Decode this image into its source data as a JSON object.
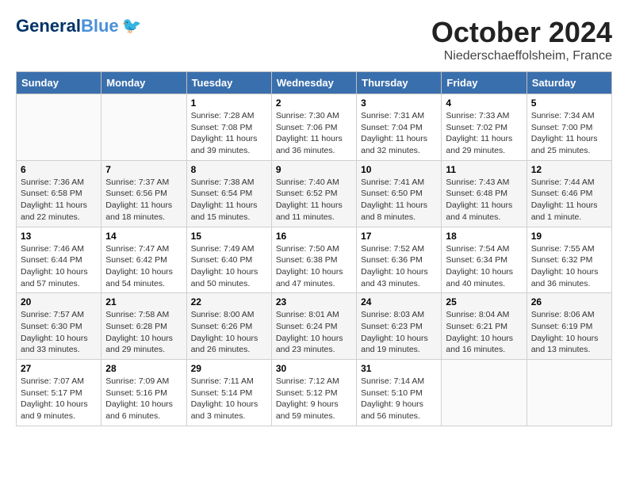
{
  "header": {
    "logo_line1": "General",
    "logo_line2": "Blue",
    "month": "October 2024",
    "location": "Niederschaeffolsheim, France"
  },
  "weekdays": [
    "Sunday",
    "Monday",
    "Tuesday",
    "Wednesday",
    "Thursday",
    "Friday",
    "Saturday"
  ],
  "weeks": [
    [
      {
        "day": "",
        "sunrise": "",
        "sunset": "",
        "daylight": ""
      },
      {
        "day": "",
        "sunrise": "",
        "sunset": "",
        "daylight": ""
      },
      {
        "day": "1",
        "sunrise": "Sunrise: 7:28 AM",
        "sunset": "Sunset: 7:08 PM",
        "daylight": "Daylight: 11 hours and 39 minutes."
      },
      {
        "day": "2",
        "sunrise": "Sunrise: 7:30 AM",
        "sunset": "Sunset: 7:06 PM",
        "daylight": "Daylight: 11 hours and 36 minutes."
      },
      {
        "day": "3",
        "sunrise": "Sunrise: 7:31 AM",
        "sunset": "Sunset: 7:04 PM",
        "daylight": "Daylight: 11 hours and 32 minutes."
      },
      {
        "day": "4",
        "sunrise": "Sunrise: 7:33 AM",
        "sunset": "Sunset: 7:02 PM",
        "daylight": "Daylight: 11 hours and 29 minutes."
      },
      {
        "day": "5",
        "sunrise": "Sunrise: 7:34 AM",
        "sunset": "Sunset: 7:00 PM",
        "daylight": "Daylight: 11 hours and 25 minutes."
      }
    ],
    [
      {
        "day": "6",
        "sunrise": "Sunrise: 7:36 AM",
        "sunset": "Sunset: 6:58 PM",
        "daylight": "Daylight: 11 hours and 22 minutes."
      },
      {
        "day": "7",
        "sunrise": "Sunrise: 7:37 AM",
        "sunset": "Sunset: 6:56 PM",
        "daylight": "Daylight: 11 hours and 18 minutes."
      },
      {
        "day": "8",
        "sunrise": "Sunrise: 7:38 AM",
        "sunset": "Sunset: 6:54 PM",
        "daylight": "Daylight: 11 hours and 15 minutes."
      },
      {
        "day": "9",
        "sunrise": "Sunrise: 7:40 AM",
        "sunset": "Sunset: 6:52 PM",
        "daylight": "Daylight: 11 hours and 11 minutes."
      },
      {
        "day": "10",
        "sunrise": "Sunrise: 7:41 AM",
        "sunset": "Sunset: 6:50 PM",
        "daylight": "Daylight: 11 hours and 8 minutes."
      },
      {
        "day": "11",
        "sunrise": "Sunrise: 7:43 AM",
        "sunset": "Sunset: 6:48 PM",
        "daylight": "Daylight: 11 hours and 4 minutes."
      },
      {
        "day": "12",
        "sunrise": "Sunrise: 7:44 AM",
        "sunset": "Sunset: 6:46 PM",
        "daylight": "Daylight: 11 hours and 1 minute."
      }
    ],
    [
      {
        "day": "13",
        "sunrise": "Sunrise: 7:46 AM",
        "sunset": "Sunset: 6:44 PM",
        "daylight": "Daylight: 10 hours and 57 minutes."
      },
      {
        "day": "14",
        "sunrise": "Sunrise: 7:47 AM",
        "sunset": "Sunset: 6:42 PM",
        "daylight": "Daylight: 10 hours and 54 minutes."
      },
      {
        "day": "15",
        "sunrise": "Sunrise: 7:49 AM",
        "sunset": "Sunset: 6:40 PM",
        "daylight": "Daylight: 10 hours and 50 minutes."
      },
      {
        "day": "16",
        "sunrise": "Sunrise: 7:50 AM",
        "sunset": "Sunset: 6:38 PM",
        "daylight": "Daylight: 10 hours and 47 minutes."
      },
      {
        "day": "17",
        "sunrise": "Sunrise: 7:52 AM",
        "sunset": "Sunset: 6:36 PM",
        "daylight": "Daylight: 10 hours and 43 minutes."
      },
      {
        "day": "18",
        "sunrise": "Sunrise: 7:54 AM",
        "sunset": "Sunset: 6:34 PM",
        "daylight": "Daylight: 10 hours and 40 minutes."
      },
      {
        "day": "19",
        "sunrise": "Sunrise: 7:55 AM",
        "sunset": "Sunset: 6:32 PM",
        "daylight": "Daylight: 10 hours and 36 minutes."
      }
    ],
    [
      {
        "day": "20",
        "sunrise": "Sunrise: 7:57 AM",
        "sunset": "Sunset: 6:30 PM",
        "daylight": "Daylight: 10 hours and 33 minutes."
      },
      {
        "day": "21",
        "sunrise": "Sunrise: 7:58 AM",
        "sunset": "Sunset: 6:28 PM",
        "daylight": "Daylight: 10 hours and 29 minutes."
      },
      {
        "day": "22",
        "sunrise": "Sunrise: 8:00 AM",
        "sunset": "Sunset: 6:26 PM",
        "daylight": "Daylight: 10 hours and 26 minutes."
      },
      {
        "day": "23",
        "sunrise": "Sunrise: 8:01 AM",
        "sunset": "Sunset: 6:24 PM",
        "daylight": "Daylight: 10 hours and 23 minutes."
      },
      {
        "day": "24",
        "sunrise": "Sunrise: 8:03 AM",
        "sunset": "Sunset: 6:23 PM",
        "daylight": "Daylight: 10 hours and 19 minutes."
      },
      {
        "day": "25",
        "sunrise": "Sunrise: 8:04 AM",
        "sunset": "Sunset: 6:21 PM",
        "daylight": "Daylight: 10 hours and 16 minutes."
      },
      {
        "day": "26",
        "sunrise": "Sunrise: 8:06 AM",
        "sunset": "Sunset: 6:19 PM",
        "daylight": "Daylight: 10 hours and 13 minutes."
      }
    ],
    [
      {
        "day": "27",
        "sunrise": "Sunrise: 7:07 AM",
        "sunset": "Sunset: 5:17 PM",
        "daylight": "Daylight: 10 hours and 9 minutes."
      },
      {
        "day": "28",
        "sunrise": "Sunrise: 7:09 AM",
        "sunset": "Sunset: 5:16 PM",
        "daylight": "Daylight: 10 hours and 6 minutes."
      },
      {
        "day": "29",
        "sunrise": "Sunrise: 7:11 AM",
        "sunset": "Sunset: 5:14 PM",
        "daylight": "Daylight: 10 hours and 3 minutes."
      },
      {
        "day": "30",
        "sunrise": "Sunrise: 7:12 AM",
        "sunset": "Sunset: 5:12 PM",
        "daylight": "Daylight: 9 hours and 59 minutes."
      },
      {
        "day": "31",
        "sunrise": "Sunrise: 7:14 AM",
        "sunset": "Sunset: 5:10 PM",
        "daylight": "Daylight: 9 hours and 56 minutes."
      },
      {
        "day": "",
        "sunrise": "",
        "sunset": "",
        "daylight": ""
      },
      {
        "day": "",
        "sunrise": "",
        "sunset": "",
        "daylight": ""
      }
    ]
  ]
}
